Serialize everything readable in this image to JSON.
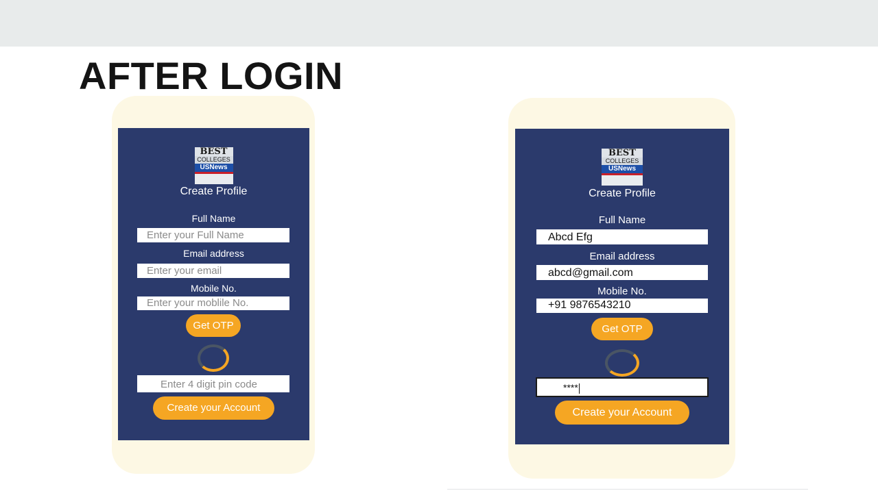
{
  "slide": {
    "title": "AFTER LOGIN"
  },
  "logo": {
    "best": "BEST",
    "colleges": "COLLEGES",
    "usnews": "USNews"
  },
  "left_screen": {
    "heading": "Create Profile",
    "full_name_label": "Full Name",
    "full_name_placeholder": "Enter your Full Name",
    "email_label": "Email address",
    "email_placeholder": "Enter your email",
    "mobile_label": "Mobile No.",
    "mobile_placeholder": "Enter your moblile No.",
    "get_otp_label": "Get OTP",
    "pin_placeholder": "Enter 4 digit pin code",
    "create_account_label": "Create your Account"
  },
  "right_screen": {
    "heading": "Create Profile",
    "full_name_label": "Full Name",
    "full_name_value": "Abcd Efg",
    "email_label": "Email address",
    "email_value": "abcd@gmail.com",
    "mobile_label": "Mobile No.",
    "mobile_value": "+91 9876543210",
    "get_otp_label": "Get OTP",
    "pin_value": "****",
    "create_account_label": "Create your Account"
  },
  "colors": {
    "screen_bg": "#2b3a6c",
    "phone_frame": "#fdf8e4",
    "button": "#f5a623",
    "topbar": "#e8ebeb"
  },
  "icons": {
    "logo": "us-news-best-colleges-badge",
    "loading": "loading-spinner-icon"
  }
}
